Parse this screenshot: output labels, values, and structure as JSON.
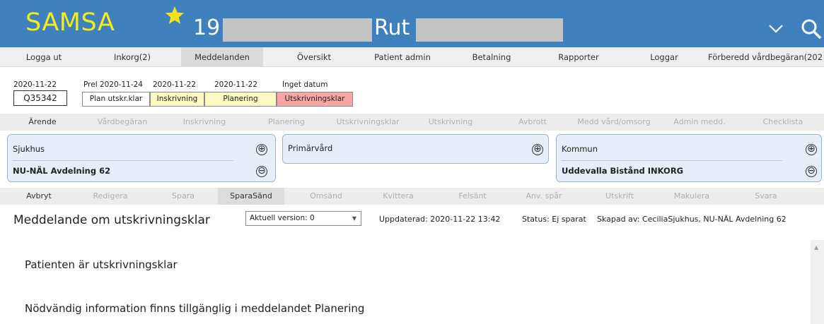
{
  "header": {
    "logo": "SAMSA",
    "patient_number_prefix": "19",
    "patient_name": "Rut",
    "star_icon": "star-icon",
    "dropdown_icon": "chevron-down-icon",
    "search_icon": "search-icon",
    "colors": {
      "bar": "#3f80be",
      "logo": "#f2ec1a",
      "star": "#f5e31a"
    }
  },
  "nav": {
    "items": [
      {
        "label": "Logga ut"
      },
      {
        "label": "Inkorg(2)"
      },
      {
        "label": "Meddelanden",
        "active": true
      },
      {
        "label": "Översikt"
      },
      {
        "label": "Patient admin"
      },
      {
        "label": "Betalning"
      },
      {
        "label": "Rapporter"
      },
      {
        "label": "Loggar"
      },
      {
        "label": "Förberedd vårdbegäran(202"
      }
    ]
  },
  "status": {
    "case_date": "2020-11-22",
    "case_id": "Q35342",
    "plan_date": "Prel 2020-11-24",
    "plan_label": "Plan utskr.klar",
    "inskrivning_date": "2020-11-22",
    "inskrivning_label": "Inskrivning",
    "planering_date": "2020-11-22",
    "planering_label": "Planering",
    "utskrivningsklar_date": "Inget datum",
    "utskrivningsklar_label": "Utskrivningsklar",
    "colors": {
      "inskrivning": "#fdf7c3",
      "planering": "#fdf7c3",
      "utskrivningsklar": "#f7a6a6"
    }
  },
  "tabs": {
    "items": [
      {
        "label": "Ärende",
        "enabled": true
      },
      {
        "label": "Vårdbegäran",
        "enabled": false
      },
      {
        "label": "Inskrivning",
        "enabled": false
      },
      {
        "label": "Planering",
        "enabled": false
      },
      {
        "label": "Utskrivningsklar",
        "enabled": false
      },
      {
        "label": "Utskrivning",
        "enabled": false
      },
      {
        "label": "Avbrott",
        "enabled": false
      },
      {
        "label": "Medd vård/omsorg",
        "enabled": false
      },
      {
        "label": "Admin medd.",
        "enabled": false
      },
      {
        "label": "Checklista",
        "enabled": false
      }
    ]
  },
  "panels": {
    "sjukhus": {
      "label": "Sjukhus",
      "unit": "NU-NÄL Avdelning 62"
    },
    "primarvard": {
      "label": "Primärvård",
      "unit": ""
    },
    "kommun": {
      "label": "Kommun",
      "unit": "Uddevalla Bistånd INKORG"
    },
    "add_symbol": "⊕",
    "remove_symbol": "⊖"
  },
  "actions": {
    "items": [
      {
        "label": "Avbryt",
        "enabled": true
      },
      {
        "label": "Redigera",
        "enabled": false
      },
      {
        "label": "Spara",
        "enabled": false
      },
      {
        "label": "SparaSänd",
        "enabled": true
      },
      {
        "label": "Omsänd",
        "enabled": false
      },
      {
        "label": "Kvittera",
        "enabled": false
      },
      {
        "label": "Felsänt",
        "enabled": false
      },
      {
        "label": "Anv. spår",
        "enabled": false
      },
      {
        "label": "Utskrift",
        "enabled": false
      },
      {
        "label": "Makulera",
        "enabled": false
      },
      {
        "label": "Svara",
        "enabled": false
      }
    ]
  },
  "message": {
    "title": "Meddelande om utskrivningsklar",
    "version_selected": "Aktuell version: 0",
    "updated": "Uppdaterad: 2020-11-22 13:42",
    "status": "Status: Ej sparat",
    "created_by": "Skapad av: CeciliaSjukhus, NU-NÄL Avdelning 62",
    "body_line1": "Patienten är utskrivningsklar",
    "body_line2": "Nödvändig information finns tillgänglig i meddelandet Planering"
  }
}
